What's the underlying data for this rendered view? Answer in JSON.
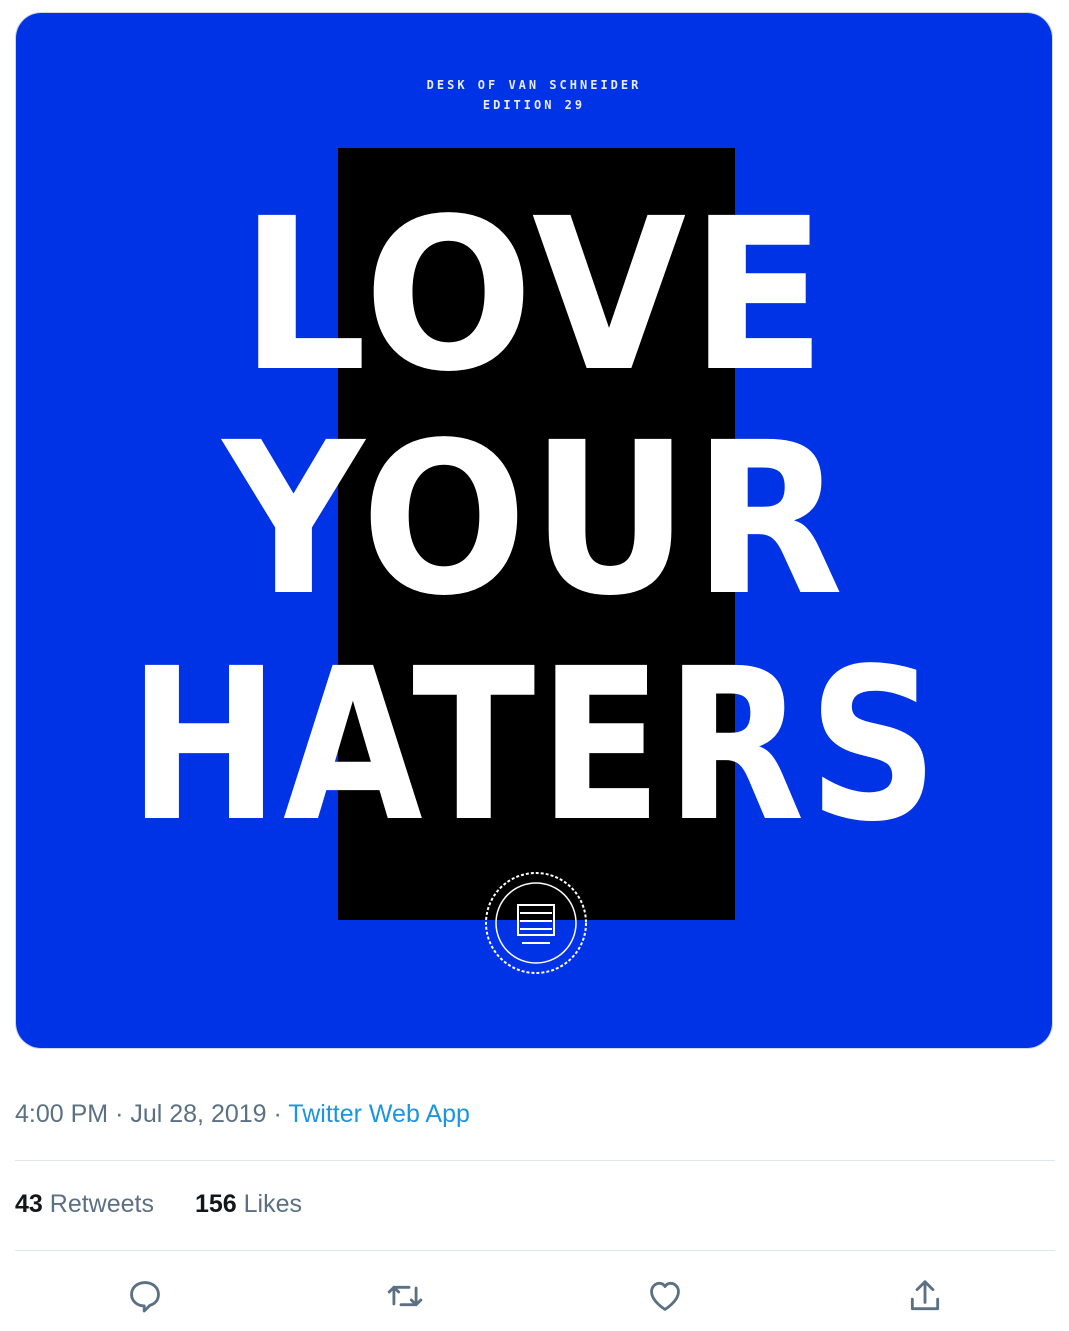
{
  "media": {
    "background_color": "#0033e6",
    "header_line1": "DESK OF VAN SCHNEIDER",
    "header_line2": "EDITION 29",
    "line1": "LOVE",
    "line2": "YOUR",
    "line3": "HATERS"
  },
  "meta": {
    "time": "4:00 PM",
    "separator": "·",
    "date": "Jul 28, 2019",
    "source": "Twitter Web App"
  },
  "stats": {
    "retweets_count": "43",
    "retweets_label": "Retweets",
    "likes_count": "156",
    "likes_label": "Likes"
  },
  "actions": {
    "icon_color": "#5b7083",
    "reply_icon": "reply-icon",
    "retweet_icon": "retweet-icon",
    "like_icon": "heart-icon",
    "share_icon": "share-icon"
  }
}
